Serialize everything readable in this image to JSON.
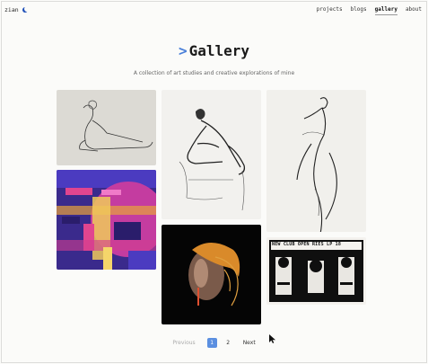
{
  "header": {
    "brand": "zian",
    "theme_icon": "moon-icon"
  },
  "nav": {
    "items": [
      "projects",
      "blogs",
      "gallery",
      "about"
    ],
    "active": "gallery"
  },
  "page": {
    "title_prefix": ">",
    "title": "Gallery",
    "subtitle": "A collection of art studies and creative explorations of mine"
  },
  "gallery": {
    "poster_text": "NEW CLUB OPEN RIES LP 18"
  },
  "pagination": {
    "previous": "Previous",
    "pages": [
      "1",
      "2"
    ],
    "current": "1",
    "next": "Next"
  },
  "colors": {
    "accent": "#4a7fd9",
    "page_bg": "#fbfbf9",
    "current_page": "#5b8fe0"
  }
}
